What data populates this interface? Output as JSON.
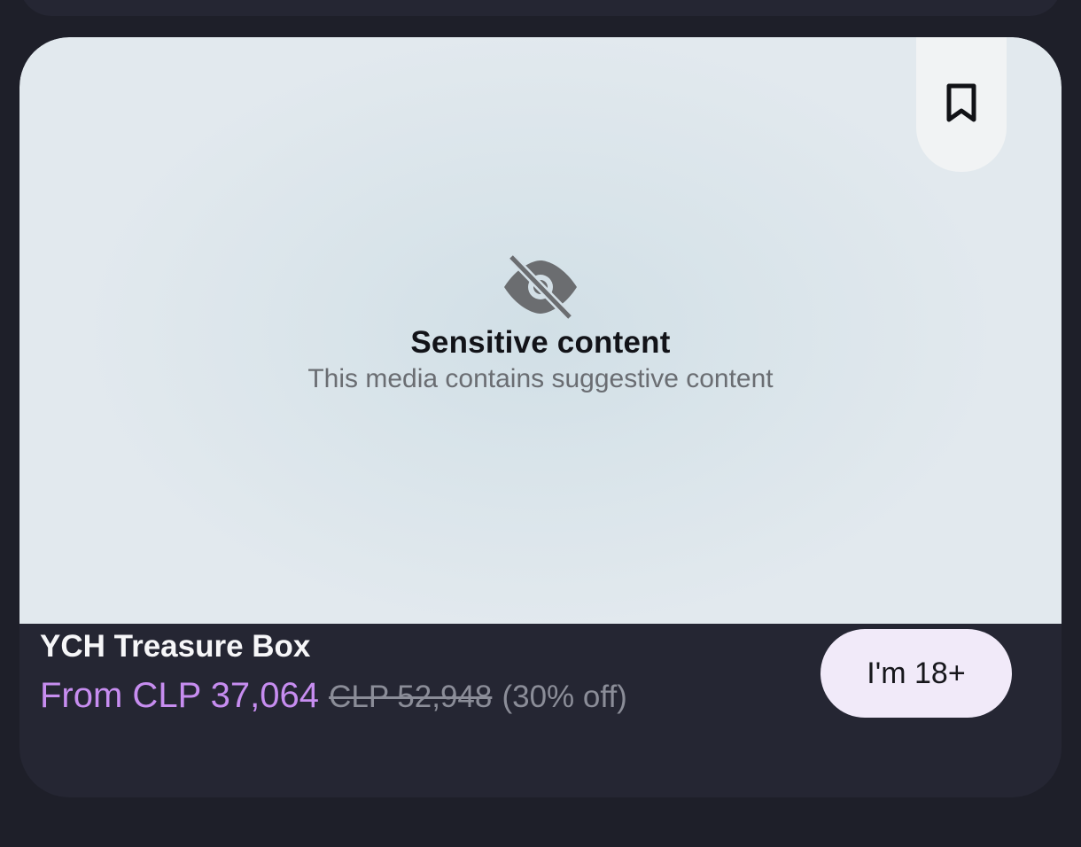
{
  "card": {
    "bookmark_icon": "bookmark-icon",
    "sensitive": {
      "icon": "eye-off-icon",
      "title": "Sensitive content",
      "subtitle": "This media contains suggestive content"
    },
    "product": {
      "title": "YCH Treasure Box",
      "price_from": "From CLP 37,064",
      "original_price": "CLP 52,948",
      "discount": "(30% off)"
    },
    "age_button_label": "I'm 18+"
  },
  "colors": {
    "page_background": "#1e1f29",
    "card_background": "#252633",
    "price_accent": "#c78df0",
    "age_button_background": "#f1eaf9"
  }
}
